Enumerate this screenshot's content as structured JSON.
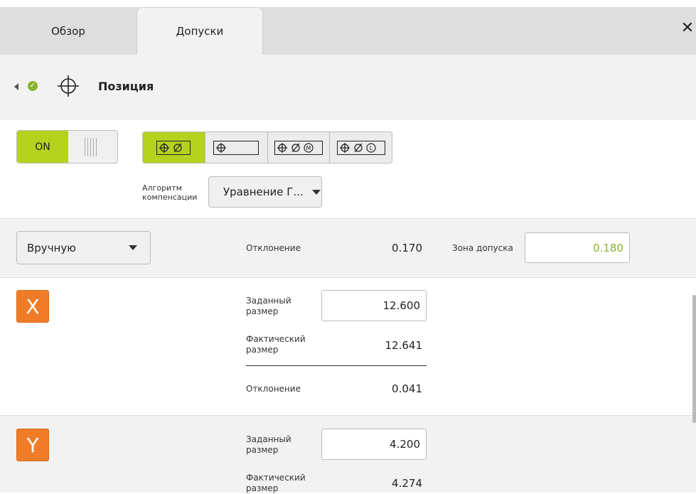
{
  "tabs": [
    {
      "label": "Обзор"
    },
    {
      "label": "Допуски"
    }
  ],
  "close_icon": "close-icon",
  "header": {
    "title": "Позиция",
    "status_color": "#8bb22a"
  },
  "toggle": {
    "label": "ON",
    "state": "on",
    "accent": "#b5d21e"
  },
  "tolerance_modes": [
    {
      "name": "position-diameter",
      "active": true
    },
    {
      "name": "position-plain",
      "active": false
    },
    {
      "name": "position-diameter-mmc",
      "active": false
    },
    {
      "name": "position-diameter-lmc",
      "active": false
    }
  ],
  "algorithm": {
    "label_line1": "Алгоритм",
    "label_line2": "компенсации",
    "value": "Уравнение Г..."
  },
  "summary": {
    "mode": "Вручную",
    "deviation_label": "Отклонение",
    "deviation_value": "0.170",
    "zone_label": "Зона допуска",
    "zone_value": "0.180",
    "zone_color": "#8bb22a"
  },
  "axes": [
    {
      "axis": "X",
      "nominal_label_1": "Заданный",
      "nominal_label_2": "размер",
      "nominal_value": "12.600",
      "actual_label_1": "Фактический",
      "actual_label_2": "размер",
      "actual_value": "12.641",
      "deviation_label": "Отклонение",
      "deviation_value": "0.041"
    },
    {
      "axis": "Y",
      "nominal_label_1": "Заданный",
      "nominal_label_2": "размер",
      "nominal_value": "4.200",
      "actual_label_1": "Фактический",
      "actual_label_2": "размер",
      "actual_value": "4.274"
    }
  ],
  "axis_color": "#f07c28"
}
